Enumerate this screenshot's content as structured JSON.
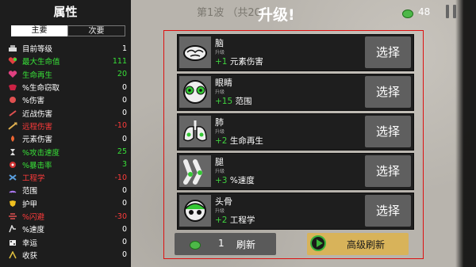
{
  "stats": {
    "title": "属性",
    "tabs": [
      {
        "label": "主要"
      },
      {
        "label": "次要"
      }
    ],
    "items": [
      {
        "name": "目前等级",
        "value": "1",
        "color": "#ffffff",
        "icon": "level-icon"
      },
      {
        "name": "最大生命值",
        "value": "111",
        "color": "#38e038",
        "icon": "heart-icon"
      },
      {
        "name": "生命再生",
        "value": "20",
        "color": "#38e038",
        "icon": "regen-icon"
      },
      {
        "name": "%生命窃取",
        "value": "0",
        "color": "#ffffff",
        "icon": "lifesteal-icon"
      },
      {
        "name": "%伤害",
        "value": "0",
        "color": "#ffffff",
        "icon": "damage-icon"
      },
      {
        "name": "近战伤害",
        "value": "0",
        "color": "#ffffff",
        "icon": "melee-icon"
      },
      {
        "name": "远程伤害",
        "value": "-10",
        "color": "#ff3b3b",
        "icon": "ranged-icon"
      },
      {
        "name": "元素伤害",
        "value": "0",
        "color": "#ffffff",
        "icon": "elemental-icon"
      },
      {
        "name": "%攻击速度",
        "value": "25",
        "color": "#38e038",
        "icon": "attack-speed-icon"
      },
      {
        "name": "%暴击率",
        "value": "3",
        "color": "#38e038",
        "icon": "crit-icon"
      },
      {
        "name": "工程学",
        "value": "-10",
        "color": "#ff3b3b",
        "icon": "engineering-icon"
      },
      {
        "name": "范围",
        "value": "0",
        "color": "#ffffff",
        "icon": "range-icon"
      },
      {
        "name": "护甲",
        "value": "0",
        "color": "#ffffff",
        "icon": "armor-icon"
      },
      {
        "name": "%闪避",
        "value": "-30",
        "color": "#ff3b3b",
        "icon": "dodge-icon"
      },
      {
        "name": "%速度",
        "value": "0",
        "color": "#ffffff",
        "icon": "speed-icon"
      },
      {
        "name": "幸运",
        "value": "0",
        "color": "#ffffff",
        "icon": "luck-icon"
      },
      {
        "name": "收获",
        "value": "0",
        "color": "#ffffff",
        "icon": "harvest-icon"
      }
    ]
  },
  "header": {
    "wave": "第1波 （共20",
    "title": "升级!",
    "coins": "48"
  },
  "upgrades": [
    {
      "name": "脑",
      "tier": "升级",
      "amount": "+1",
      "effect": "元素伤害",
      "choose": "选择",
      "icon": "brain-icon"
    },
    {
      "name": "眼睛",
      "tier": "升级",
      "amount": "+15",
      "effect": "范围",
      "choose": "选择",
      "icon": "eyes-icon"
    },
    {
      "name": "肺",
      "tier": "升级",
      "amount": "+2",
      "effect": "生命再生",
      "choose": "选择",
      "icon": "lungs-icon"
    },
    {
      "name": "腿",
      "tier": "升级",
      "amount": "+3",
      "effect": "%速度",
      "choose": "选择",
      "icon": "legs-icon"
    },
    {
      "name": "头骨",
      "tier": "升级",
      "amount": "+2",
      "effect": "工程学",
      "choose": "选择",
      "icon": "skull-icon"
    }
  ],
  "reroll": {
    "count": "1",
    "label": "刷新"
  },
  "advanced_reroll": {
    "label": "高级刷新"
  },
  "colors": {
    "accent_green": "#3fd23f",
    "negative_red": "#ff3b3b",
    "panel_border": "#dd1111",
    "gold_button": "#d8b35a"
  }
}
